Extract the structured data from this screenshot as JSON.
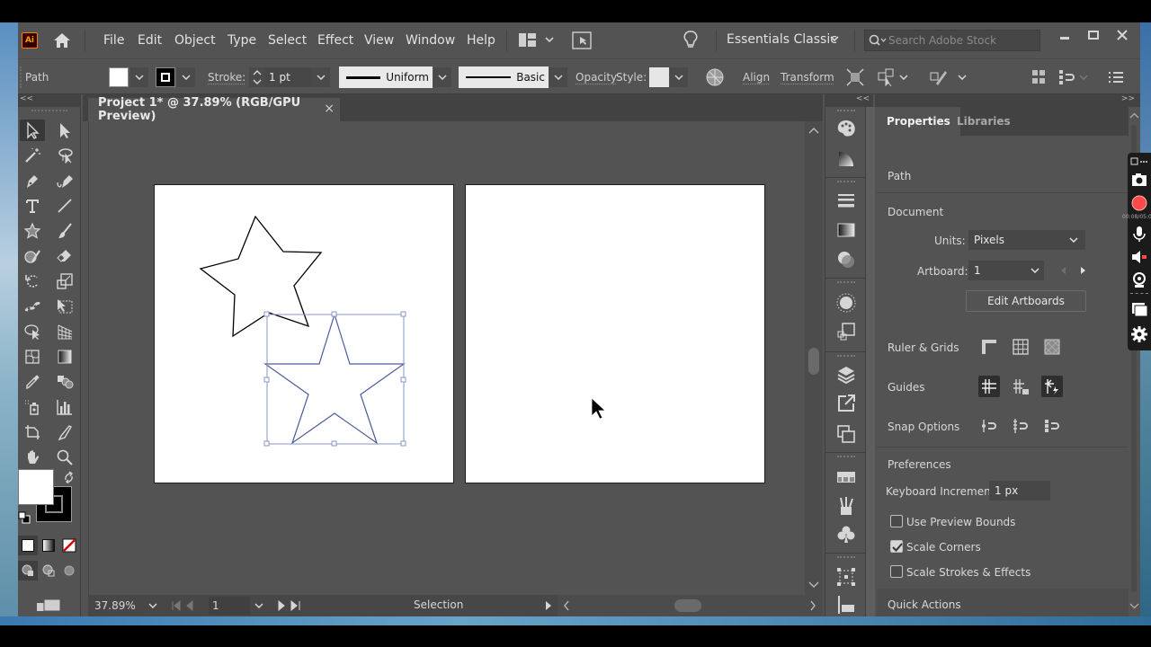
{
  "app": {
    "logo_text": "Ai",
    "menu": [
      "File",
      "Edit",
      "Object",
      "Type",
      "Select",
      "Effect",
      "View",
      "Window",
      "Help"
    ],
    "workspace": "Essentials Classic",
    "search_placeholder": "Search Adobe Stock",
    "window_controls": [
      "minimize",
      "maximize",
      "close"
    ]
  },
  "control_bar": {
    "selection_type": "Path",
    "fill_color": "#ffffff",
    "stroke_color": "#000000",
    "stroke_label": "Stroke:",
    "stroke_weight": "1 pt",
    "variable_width_profile": "Uniform",
    "brush_definition": "Basic",
    "opacity_label": "Opacity",
    "style_label": "Style:",
    "align_label": "Align",
    "transform_label": "Transform"
  },
  "document": {
    "tab_title": "Project 1* @ 37.89% (RGB/GPU Preview)",
    "close_glyph": "×",
    "artboards": [
      "Artboard 1",
      "Artboard 2"
    ],
    "shapes": [
      {
        "type": "star",
        "points": 5,
        "selected": false,
        "stroke": "#000000"
      },
      {
        "type": "star",
        "points": 5,
        "selected": true,
        "stroke": "#4b5a9a"
      }
    ]
  },
  "status_bar": {
    "zoom": "37.89%",
    "artboard_number": "1",
    "current_tool": "Selection"
  },
  "tools": [
    "selection",
    "direct-selection",
    "magic-wand",
    "lasso",
    "pen",
    "curvature",
    "type",
    "line-segment",
    "star",
    "paintbrush",
    "shaper",
    "eraser",
    "rotate",
    "scale",
    "puppet-warp",
    "free-transform",
    "shape-builder",
    "perspective-grid",
    "mesh",
    "gradient",
    "eyedropper",
    "blend",
    "symbol-sprayer",
    "column-graph",
    "artboard",
    "slice",
    "hand",
    "zoom"
  ],
  "properties_panel": {
    "tabs": [
      {
        "label": "Properties",
        "active": true
      },
      {
        "label": "Libraries",
        "active": false
      }
    ],
    "selection_heading": "Path",
    "document_heading": "Document",
    "units_label": "Units:",
    "units_value": "Pixels",
    "artboard_label": "Artboard:",
    "artboard_value": "1",
    "edit_artboards_label": "Edit Artboards",
    "ruler_grids_label": "Ruler & Grids",
    "guides_label": "Guides",
    "snap_options_label": "Snap Options",
    "preferences_heading": "Preferences",
    "keyboard_increment_label": "Keyboard Increment:",
    "keyboard_increment_value": "1 px",
    "checkboxes": [
      {
        "label": "Use Preview Bounds",
        "checked": false
      },
      {
        "label": "Scale Corners",
        "checked": true
      },
      {
        "label": "Scale Strokes & Effects",
        "checked": false
      }
    ],
    "quick_actions_heading": "Quick Actions"
  },
  "recorder": {
    "timer": "00:08/05:00",
    "record_color": "#ff4a4a"
  }
}
